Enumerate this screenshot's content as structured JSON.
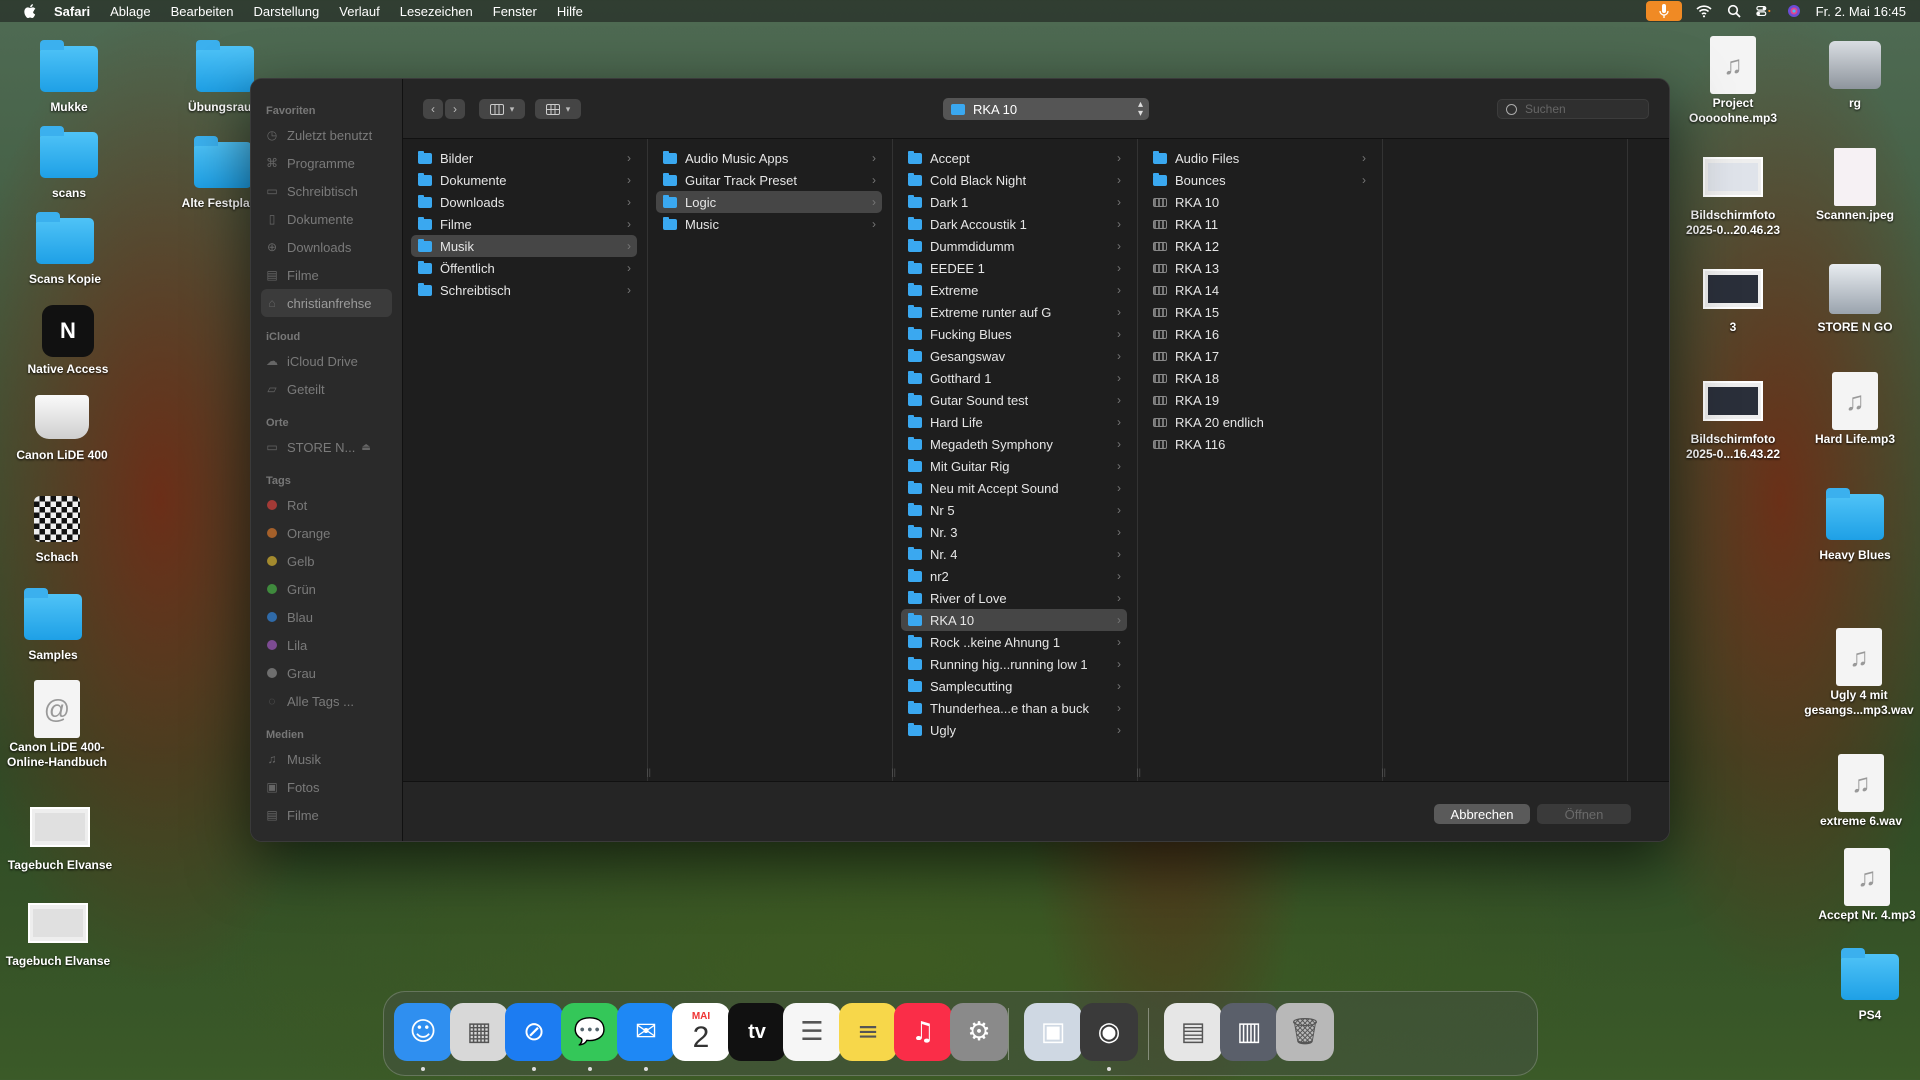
{
  "menubar": {
    "app_name": "Safari",
    "items": [
      "Ablage",
      "Bearbeiten",
      "Darstellung",
      "Verlauf",
      "Lesezeichen",
      "Fenster",
      "Hilfe"
    ],
    "clock": "Fr. 2. Mai  16:45"
  },
  "desktop": {
    "left_icons": [
      {
        "label": "Mukke",
        "kind": "folder"
      },
      {
        "label": "Übungsraum",
        "kind": "folder"
      },
      {
        "label": "scans",
        "kind": "folder"
      },
      {
        "label": "Alte Festplatte",
        "kind": "folder"
      },
      {
        "label": "Scans Kopie",
        "kind": "folder"
      },
      {
        "label": "Native Access",
        "kind": "app"
      },
      {
        "label": "Canon LiDE 400",
        "kind": "scanner"
      },
      {
        "label": "Schach",
        "kind": "chess"
      },
      {
        "label": "Samples",
        "kind": "folder"
      },
      {
        "label": "Canon LiDE 400-Online-Handbuch",
        "kind": "weblink"
      },
      {
        "label": "Tagebuch Elvanse",
        "kind": "document"
      },
      {
        "label": "Tagebuch Elvanse",
        "kind": "document"
      }
    ],
    "right_icons": [
      {
        "label": "Project Ooooohne.mp3",
        "kind": "audio"
      },
      {
        "label": "rg",
        "kind": "disk"
      },
      {
        "label": "Bildschirmfoto 2025-0...20.46.23",
        "kind": "screenshot"
      },
      {
        "label": "Scannen.jpeg",
        "kind": "image"
      },
      {
        "label": "3",
        "kind": "screenshot"
      },
      {
        "label": "STORE N GO",
        "kind": "drive"
      },
      {
        "label": "Bildschirmfoto 2025-0...16.43.22",
        "kind": "screenshot"
      },
      {
        "label": "Hard Life.mp3",
        "kind": "audio"
      },
      {
        "label": "Heavy Blues",
        "kind": "folder"
      },
      {
        "label": "Ugly 4 mit gesangs...mp3.wav",
        "kind": "audio"
      },
      {
        "label": "extreme 6.wav",
        "kind": "audio"
      },
      {
        "label": "Accept Nr. 4.mp3",
        "kind": "audio"
      },
      {
        "label": "PS4",
        "kind": "folder"
      }
    ]
  },
  "dialog": {
    "sidebar": {
      "favorites_header": "Favoriten",
      "favorites": [
        {
          "label": "Zuletzt benutzt",
          "icon": "clock-icon"
        },
        {
          "label": "Programme",
          "icon": "apps-icon"
        },
        {
          "label": "Schreibtisch",
          "icon": "desktop-icon"
        },
        {
          "label": "Dokumente",
          "icon": "document-icon"
        },
        {
          "label": "Downloads",
          "icon": "download-icon"
        },
        {
          "label": "Filme",
          "icon": "film-icon"
        },
        {
          "label": "christianfrehse",
          "icon": "home-icon",
          "selected": true
        }
      ],
      "icloud_header": "iCloud",
      "icloud": [
        {
          "label": "iCloud Drive",
          "icon": "cloud-icon"
        },
        {
          "label": "Geteilt",
          "icon": "shared-folder-icon"
        }
      ],
      "places_header": "Orte",
      "places": [
        {
          "label": "STORE N...",
          "icon": "drive-icon"
        }
      ],
      "tags_header": "Tags",
      "tags": [
        {
          "label": "Rot",
          "color": "#a33a36"
        },
        {
          "label": "Orange",
          "color": "#a5602a"
        },
        {
          "label": "Gelb",
          "color": "#a38a2e"
        },
        {
          "label": "Grün",
          "color": "#3f8a3d"
        },
        {
          "label": "Blau",
          "color": "#2f6aa8"
        },
        {
          "label": "Lila",
          "color": "#7d4b93"
        },
        {
          "label": "Grau",
          "color": "#6f6f6f"
        },
        {
          "label": "Alle Tags ...",
          "color": ""
        }
      ],
      "media_header": "Medien",
      "media": [
        {
          "label": "Musik",
          "icon": "music-note-icon"
        },
        {
          "label": "Fotos",
          "icon": "photos-icon"
        },
        {
          "label": "Filme",
          "icon": "film-icon"
        }
      ]
    },
    "toolbar": {
      "back": "‹",
      "forward": "›",
      "path_label": "RKA 10",
      "search_placeholder": "Suchen"
    },
    "columns": [
      {
        "items": [
          {
            "label": "Bilder",
            "type": "folder"
          },
          {
            "label": "Dokumente",
            "type": "folder"
          },
          {
            "label": "Downloads",
            "type": "folder"
          },
          {
            "label": "Filme",
            "type": "folder"
          },
          {
            "label": "Musik",
            "type": "folder",
            "selected": true
          },
          {
            "label": "Öffentlich",
            "type": "folder"
          },
          {
            "label": "Schreibtisch",
            "type": "folder"
          }
        ]
      },
      {
        "items": [
          {
            "label": "Audio Music Apps",
            "type": "folder"
          },
          {
            "label": "Guitar Track Preset",
            "type": "folder"
          },
          {
            "label": "Logic",
            "type": "folder",
            "selected": true
          },
          {
            "label": "Music",
            "type": "folder"
          }
        ]
      },
      {
        "items": [
          {
            "label": "Accept",
            "type": "folder"
          },
          {
            "label": "Cold Black Night",
            "type": "folder"
          },
          {
            "label": "Dark 1",
            "type": "folder"
          },
          {
            "label": "Dark Accoustik 1",
            "type": "folder"
          },
          {
            "label": "Dummdidumm",
            "type": "folder"
          },
          {
            "label": "EEDEE 1",
            "type": "folder"
          },
          {
            "label": "Extreme",
            "type": "folder"
          },
          {
            "label": "Extreme runter auf G",
            "type": "folder"
          },
          {
            "label": "Fucking Blues",
            "type": "folder"
          },
          {
            "label": "Gesangswav",
            "type": "folder"
          },
          {
            "label": "Gotthard 1",
            "type": "folder"
          },
          {
            "label": "Gutar Sound test",
            "type": "folder"
          },
          {
            "label": "Hard Life",
            "type": "folder"
          },
          {
            "label": "Megadeth Symphony",
            "type": "folder"
          },
          {
            "label": "Mit Guitar Rig",
            "type": "folder"
          },
          {
            "label": "Neu mit Accept Sound",
            "type": "folder"
          },
          {
            "label": "Nr 5",
            "type": "folder"
          },
          {
            "label": "Nr. 3",
            "type": "folder"
          },
          {
            "label": "Nr. 4",
            "type": "folder"
          },
          {
            "label": "nr2",
            "type": "folder"
          },
          {
            "label": "River of Love",
            "type": "folder"
          },
          {
            "label": "RKA 10",
            "type": "folder",
            "selected": true
          },
          {
            "label": "Rock ..keine Ahnung 1",
            "type": "folder"
          },
          {
            "label": "Running hig...running low 1",
            "type": "folder"
          },
          {
            "label": "Samplecutting",
            "type": "folder"
          },
          {
            "label": "Thunderhea...e than a buck",
            "type": "folder"
          },
          {
            "label": "Ugly",
            "type": "folder"
          }
        ]
      },
      {
        "items": [
          {
            "label": "Audio Files",
            "type": "folder",
            "chevron": true
          },
          {
            "label": "Bounces",
            "type": "folder",
            "chevron": true
          },
          {
            "label": "RKA 10",
            "type": "project"
          },
          {
            "label": "RKA 11",
            "type": "project"
          },
          {
            "label": "RKA 12",
            "type": "project"
          },
          {
            "label": "RKA 13",
            "type": "project"
          },
          {
            "label": "RKA 14",
            "type": "project"
          },
          {
            "label": "RKA 15",
            "type": "project"
          },
          {
            "label": "RKA 16",
            "type": "project"
          },
          {
            "label": "RKA 17",
            "type": "project"
          },
          {
            "label": "RKA 18",
            "type": "project"
          },
          {
            "label": "RKA 19",
            "type": "project"
          },
          {
            "label": "RKA 20 endlich",
            "type": "project"
          },
          {
            "label": "RKA 116",
            "type": "project"
          }
        ]
      },
      {
        "items": []
      }
    ],
    "footer": {
      "cancel_label": "Abbrechen",
      "open_label": "Öffnen"
    }
  },
  "dock": {
    "apps": [
      {
        "name": "Finder",
        "icon": "finder-icon",
        "color": "#2f8ff0",
        "running": true
      },
      {
        "name": "Launchpad",
        "icon": "launchpad-icon",
        "color": "#d8d8d8",
        "running": false
      },
      {
        "name": "Safari",
        "icon": "safari-icon",
        "color": "#1c7cf2",
        "running": true
      },
      {
        "name": "Messages",
        "icon": "messages-icon",
        "color": "#34c759",
        "running": true
      },
      {
        "name": "Mail",
        "icon": "mail-icon",
        "color": "#1e88f5",
        "running": true
      },
      {
        "name": "Calendar",
        "icon": "calendar-icon",
        "color": "#ffffff",
        "running": false
      },
      {
        "name": "TV",
        "icon": "tv-icon",
        "color": "#111111",
        "running": false
      },
      {
        "name": "Reminders",
        "icon": "reminders-icon",
        "color": "#f6f6f6",
        "running": false
      },
      {
        "name": "Notes",
        "icon": "notes-icon",
        "color": "#f7d74a",
        "running": false
      },
      {
        "name": "Music",
        "icon": "music-icon",
        "color": "#fa2d48",
        "running": false
      },
      {
        "name": "System Settings",
        "icon": "settings-icon",
        "color": "#8a8a8a",
        "running": false
      },
      {
        "name": "Preview",
        "icon": "preview-icon",
        "color": "#cfd8e3",
        "running": false
      },
      {
        "name": "Logic Pro",
        "icon": "logic-icon",
        "color": "#3a3a3a",
        "running": true
      },
      {
        "name": "Downloads",
        "icon": "downloads-stack-icon",
        "color": "#e6e6e6",
        "running": false
      },
      {
        "name": "Screenshot",
        "icon": "screenshot-stack-icon",
        "color": "#5a5f6a",
        "running": false
      },
      {
        "name": "Trash",
        "icon": "trash-icon",
        "color": "#b8b8b8",
        "running": false
      }
    ],
    "calendar_month": "MAI",
    "calendar_day": "2",
    "tv_label": "tv"
  }
}
